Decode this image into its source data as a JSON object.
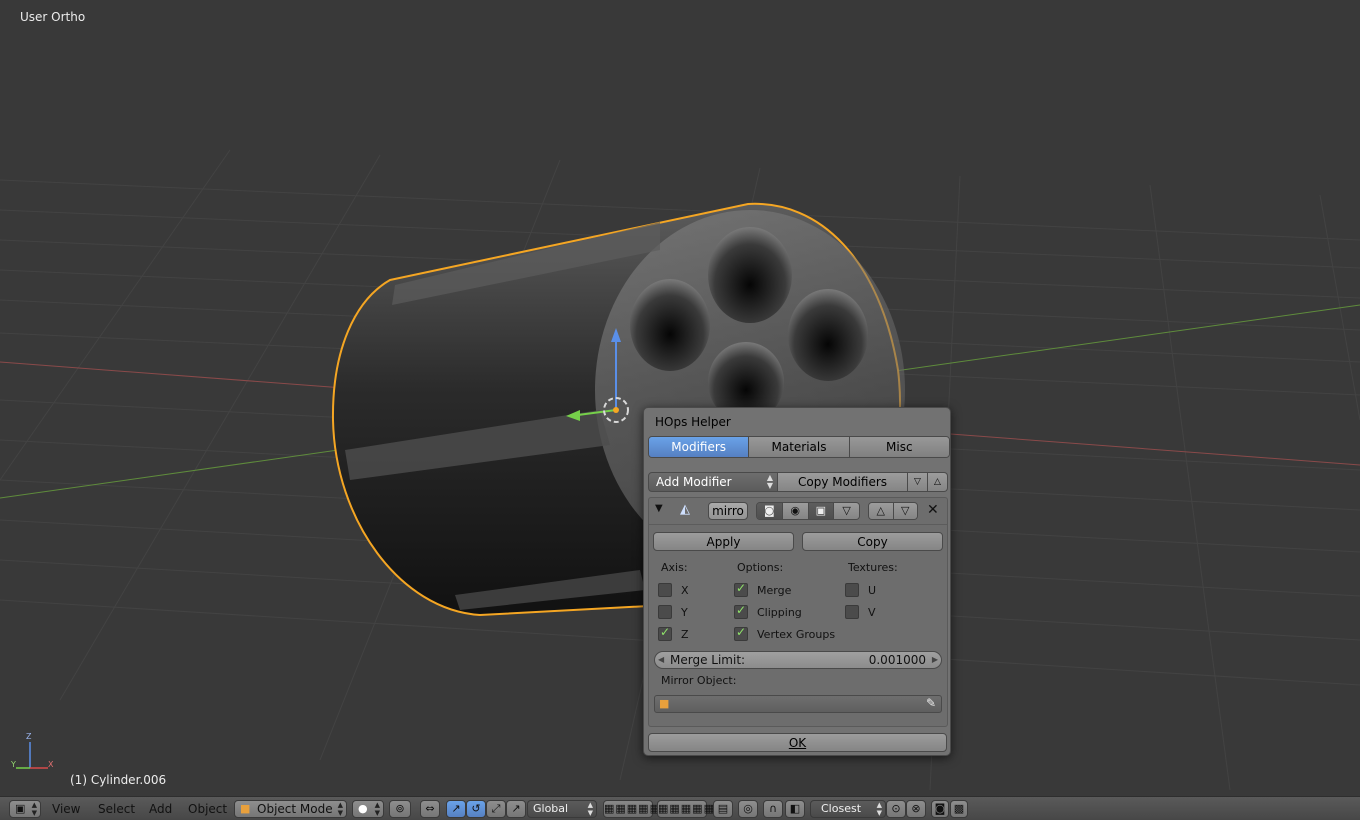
{
  "viewport": {
    "view_label": "User Ortho",
    "object_label": "(1) Cylinder.006",
    "axis_labels": {
      "z": "Z",
      "y": "Y",
      "x": "X"
    }
  },
  "popup": {
    "title": "HOps Helper",
    "tabs": [
      {
        "label": "Modifiers",
        "active": true
      },
      {
        "label": "Materials",
        "active": false
      },
      {
        "label": "Misc",
        "active": false
      }
    ],
    "add_modifier_label": "Add Modifier",
    "copy_modifiers_label": "Copy Modifiers",
    "modifier": {
      "name": "mirro",
      "apply_label": "Apply",
      "copy_label": "Copy",
      "axis_header": "Axis:",
      "options_header": "Options:",
      "textures_header": "Textures:",
      "axis": [
        {
          "label": "X",
          "checked": false
        },
        {
          "label": "Y",
          "checked": false
        },
        {
          "label": "Z",
          "checked": true
        }
      ],
      "options": [
        {
          "label": "Merge",
          "checked": true
        },
        {
          "label": "Clipping",
          "checked": true
        },
        {
          "label": "Vertex Groups",
          "checked": true
        }
      ],
      "textures": [
        {
          "label": "U",
          "checked": false
        },
        {
          "label": "V",
          "checked": false
        }
      ],
      "merge_limit_label": "Merge Limit:",
      "merge_limit_value": "0.001000",
      "mirror_object_label": "Mirror Object:",
      "mirror_object_value": ""
    },
    "ok_label": "OK"
  },
  "header": {
    "menus": [
      "View",
      "Select",
      "Add",
      "Object"
    ],
    "mode": "Object Mode",
    "orientation": "Global",
    "snap_target": "Closest"
  },
  "colors": {
    "selection_outline": "#f5a623",
    "accent_blue": "#5680c2",
    "check_green": "#8fe36a"
  }
}
